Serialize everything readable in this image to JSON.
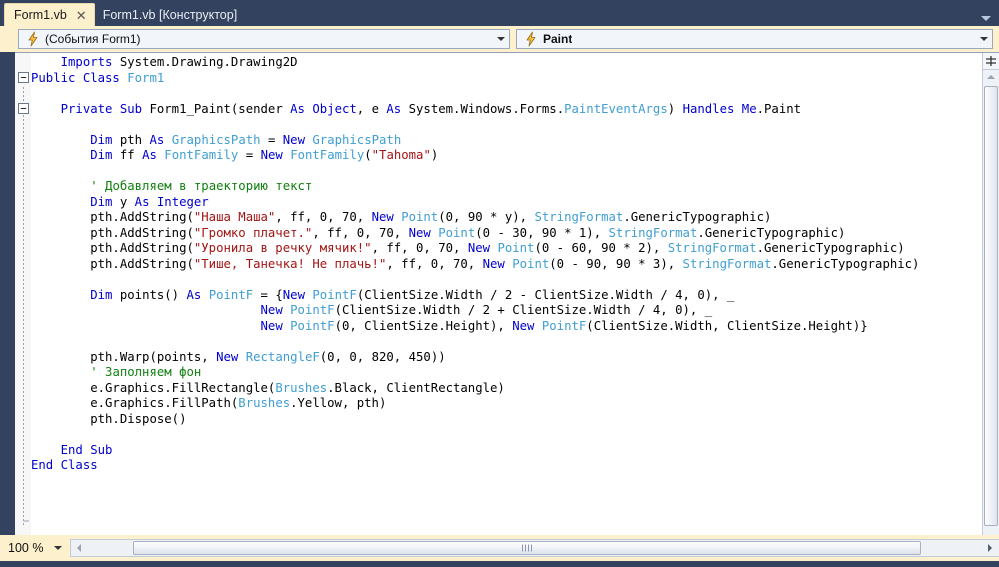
{
  "window": {
    "chrome_color": "#33425e",
    "accent_color": "#fdf0cd"
  },
  "tabstrip": {
    "chevron_icon": "chevron-down-icon",
    "tabs": [
      {
        "label": "Form1.vb",
        "active": true,
        "close_glyph": "✕"
      },
      {
        "label": "Form1.vb [Конструктор]",
        "active": false
      }
    ]
  },
  "navbar": {
    "left_combo": {
      "icon": "lightning-bolt-icon",
      "value": "(События Form1)",
      "arrow_icon": "chevron-down-icon"
    },
    "right_combo": {
      "icon": "lightning-bolt-icon",
      "value": "Paint",
      "arrow_icon": "chevron-down-icon"
    }
  },
  "editor": {
    "fold_markers": [
      {
        "line": 1,
        "glyph": "−"
      },
      {
        "line": 3,
        "glyph": "−"
      }
    ],
    "code_lines": [
      [
        {
          "t": "    ",
          "c": "pln"
        },
        {
          "t": "Imports",
          "c": "kw"
        },
        {
          "t": " System.Drawing.Drawing2D",
          "c": "pln"
        }
      ],
      [
        {
          "t": "Public Class",
          "c": "kw"
        },
        {
          "t": " ",
          "c": "pln"
        },
        {
          "t": "Form1",
          "c": "typ"
        }
      ],
      [
        {
          "t": "",
          "c": "pln"
        }
      ],
      [
        {
          "t": "    ",
          "c": "pln"
        },
        {
          "t": "Private Sub",
          "c": "kw"
        },
        {
          "t": " Form1_Paint(sender ",
          "c": "pln"
        },
        {
          "t": "As",
          "c": "kw"
        },
        {
          "t": " ",
          "c": "pln"
        },
        {
          "t": "Object",
          "c": "kw"
        },
        {
          "t": ", e ",
          "c": "pln"
        },
        {
          "t": "As",
          "c": "kw"
        },
        {
          "t": " System.Windows.Forms.",
          "c": "pln"
        },
        {
          "t": "PaintEventArgs",
          "c": "typ"
        },
        {
          "t": ") ",
          "c": "pln"
        },
        {
          "t": "Handles",
          "c": "kw"
        },
        {
          "t": " ",
          "c": "pln"
        },
        {
          "t": "Me",
          "c": "kw"
        },
        {
          "t": ".Paint",
          "c": "pln"
        }
      ],
      [
        {
          "t": "",
          "c": "pln"
        }
      ],
      [
        {
          "t": "        ",
          "c": "pln"
        },
        {
          "t": "Dim",
          "c": "kw"
        },
        {
          "t": " pth ",
          "c": "pln"
        },
        {
          "t": "As",
          "c": "kw"
        },
        {
          "t": " ",
          "c": "pln"
        },
        {
          "t": "GraphicsPath",
          "c": "typ"
        },
        {
          "t": " = ",
          "c": "pln"
        },
        {
          "t": "New",
          "c": "kw"
        },
        {
          "t": " ",
          "c": "pln"
        },
        {
          "t": "GraphicsPath",
          "c": "typ"
        }
      ],
      [
        {
          "t": "        ",
          "c": "pln"
        },
        {
          "t": "Dim",
          "c": "kw"
        },
        {
          "t": " ff ",
          "c": "pln"
        },
        {
          "t": "As",
          "c": "kw"
        },
        {
          "t": " ",
          "c": "pln"
        },
        {
          "t": "FontFamily",
          "c": "typ"
        },
        {
          "t": " = ",
          "c": "pln"
        },
        {
          "t": "New",
          "c": "kw"
        },
        {
          "t": " ",
          "c": "pln"
        },
        {
          "t": "FontFamily",
          "c": "typ"
        },
        {
          "t": "(",
          "c": "pln"
        },
        {
          "t": "\"Tahoma\"",
          "c": "str"
        },
        {
          "t": ")",
          "c": "pln"
        }
      ],
      [
        {
          "t": "",
          "c": "pln"
        }
      ],
      [
        {
          "t": "        ",
          "c": "pln"
        },
        {
          "t": "' Добавляем в траекторию текст",
          "c": "com"
        }
      ],
      [
        {
          "t": "        ",
          "c": "pln"
        },
        {
          "t": "Dim",
          "c": "kw"
        },
        {
          "t": " y ",
          "c": "pln"
        },
        {
          "t": "As",
          "c": "kw"
        },
        {
          "t": " ",
          "c": "pln"
        },
        {
          "t": "Integer",
          "c": "kw"
        }
      ],
      [
        {
          "t": "        pth.AddString(",
          "c": "pln"
        },
        {
          "t": "\"Наша Маша\"",
          "c": "str"
        },
        {
          "t": ", ff, 0, 70, ",
          "c": "pln"
        },
        {
          "t": "New",
          "c": "kw"
        },
        {
          "t": " ",
          "c": "pln"
        },
        {
          "t": "Point",
          "c": "typ"
        },
        {
          "t": "(0, 90 * y), ",
          "c": "pln"
        },
        {
          "t": "StringFormat",
          "c": "typ"
        },
        {
          "t": ".GenericTypographic)",
          "c": "pln"
        }
      ],
      [
        {
          "t": "        pth.AddString(",
          "c": "pln"
        },
        {
          "t": "\"Громко плачет.\"",
          "c": "str"
        },
        {
          "t": ", ff, 0, 70, ",
          "c": "pln"
        },
        {
          "t": "New",
          "c": "kw"
        },
        {
          "t": " ",
          "c": "pln"
        },
        {
          "t": "Point",
          "c": "typ"
        },
        {
          "t": "(0 - 30, 90 * 1), ",
          "c": "pln"
        },
        {
          "t": "StringFormat",
          "c": "typ"
        },
        {
          "t": ".GenericTypographic)",
          "c": "pln"
        }
      ],
      [
        {
          "t": "        pth.AddString(",
          "c": "pln"
        },
        {
          "t": "\"Уронила в речку мячик!\"",
          "c": "str"
        },
        {
          "t": ", ff, 0, 70, ",
          "c": "pln"
        },
        {
          "t": "New",
          "c": "kw"
        },
        {
          "t": " ",
          "c": "pln"
        },
        {
          "t": "Point",
          "c": "typ"
        },
        {
          "t": "(0 - 60, 90 * 2), ",
          "c": "pln"
        },
        {
          "t": "StringFormat",
          "c": "typ"
        },
        {
          "t": ".GenericTypographic)",
          "c": "pln"
        }
      ],
      [
        {
          "t": "        pth.AddString(",
          "c": "pln"
        },
        {
          "t": "\"Тише, Танечка! Не плачь!\"",
          "c": "str"
        },
        {
          "t": ", ff, 0, 70, ",
          "c": "pln"
        },
        {
          "t": "New",
          "c": "kw"
        },
        {
          "t": " ",
          "c": "pln"
        },
        {
          "t": "Point",
          "c": "typ"
        },
        {
          "t": "(0 - 90, 90 * 3), ",
          "c": "pln"
        },
        {
          "t": "StringFormat",
          "c": "typ"
        },
        {
          "t": ".GenericTypographic)",
          "c": "pln"
        }
      ],
      [
        {
          "t": "",
          "c": "pln"
        }
      ],
      [
        {
          "t": "        ",
          "c": "pln"
        },
        {
          "t": "Dim",
          "c": "kw"
        },
        {
          "t": " points() ",
          "c": "pln"
        },
        {
          "t": "As",
          "c": "kw"
        },
        {
          "t": " ",
          "c": "pln"
        },
        {
          "t": "PointF",
          "c": "typ"
        },
        {
          "t": " = {",
          "c": "pln"
        },
        {
          "t": "New",
          "c": "kw"
        },
        {
          "t": " ",
          "c": "pln"
        },
        {
          "t": "PointF",
          "c": "typ"
        },
        {
          "t": "(ClientSize.Width / 2 - ClientSize.Width / 4, 0), _",
          "c": "pln"
        }
      ],
      [
        {
          "t": "                               ",
          "c": "pln"
        },
        {
          "t": "New",
          "c": "kw"
        },
        {
          "t": " ",
          "c": "pln"
        },
        {
          "t": "PointF",
          "c": "typ"
        },
        {
          "t": "(ClientSize.Width / 2 + ClientSize.Width / 4, 0), _",
          "c": "pln"
        }
      ],
      [
        {
          "t": "                               ",
          "c": "pln"
        },
        {
          "t": "New",
          "c": "kw"
        },
        {
          "t": " ",
          "c": "pln"
        },
        {
          "t": "PointF",
          "c": "typ"
        },
        {
          "t": "(0, ClientSize.Height), ",
          "c": "pln"
        },
        {
          "t": "New",
          "c": "kw"
        },
        {
          "t": " ",
          "c": "pln"
        },
        {
          "t": "PointF",
          "c": "typ"
        },
        {
          "t": "(ClientSize.Width, ClientSize.Height)}",
          "c": "pln"
        }
      ],
      [
        {
          "t": "",
          "c": "pln"
        }
      ],
      [
        {
          "t": "        pth.Warp(points, ",
          "c": "pln"
        },
        {
          "t": "New",
          "c": "kw"
        },
        {
          "t": " ",
          "c": "pln"
        },
        {
          "t": "RectangleF",
          "c": "typ"
        },
        {
          "t": "(0, 0, 820, 450))",
          "c": "pln"
        }
      ],
      [
        {
          "t": "        ",
          "c": "pln"
        },
        {
          "t": "' Заполняем фон",
          "c": "com"
        }
      ],
      [
        {
          "t": "        e.Graphics.FillRectangle(",
          "c": "pln"
        },
        {
          "t": "Brushes",
          "c": "typ"
        },
        {
          "t": ".Black, ClientRectangle)",
          "c": "pln"
        }
      ],
      [
        {
          "t": "        e.Graphics.FillPath(",
          "c": "pln"
        },
        {
          "t": "Brushes",
          "c": "typ"
        },
        {
          "t": ".Yellow, pth)",
          "c": "pln"
        }
      ],
      [
        {
          "t": "        pth.Dispose()",
          "c": "pln"
        }
      ],
      [
        {
          "t": "",
          "c": "pln"
        }
      ],
      [
        {
          "t": "    ",
          "c": "pln"
        },
        {
          "t": "End Sub",
          "c": "kw"
        }
      ],
      [
        {
          "t": "",
          "c": "pln"
        },
        {
          "t": "End Class",
          "c": "kw"
        }
      ]
    ],
    "syntax_colors": {
      "keyword": "#0000cf",
      "type": "#3f9ed3",
      "string": "#a31515",
      "comment": "#108010",
      "plain": "#000000"
    }
  },
  "vertical_scrollbar": {
    "split_icon": "split-view-icon",
    "up_arrow_icon": "triangle-up-icon",
    "thumb_name": "vertical-scroll-thumb"
  },
  "statusbar": {
    "zoom_value": "100 %",
    "zoom_arrow_icon": "chevron-down-icon",
    "left_arrow_icon": "triangle-left-icon",
    "right_arrow_icon": "triangle-right-icon"
  }
}
